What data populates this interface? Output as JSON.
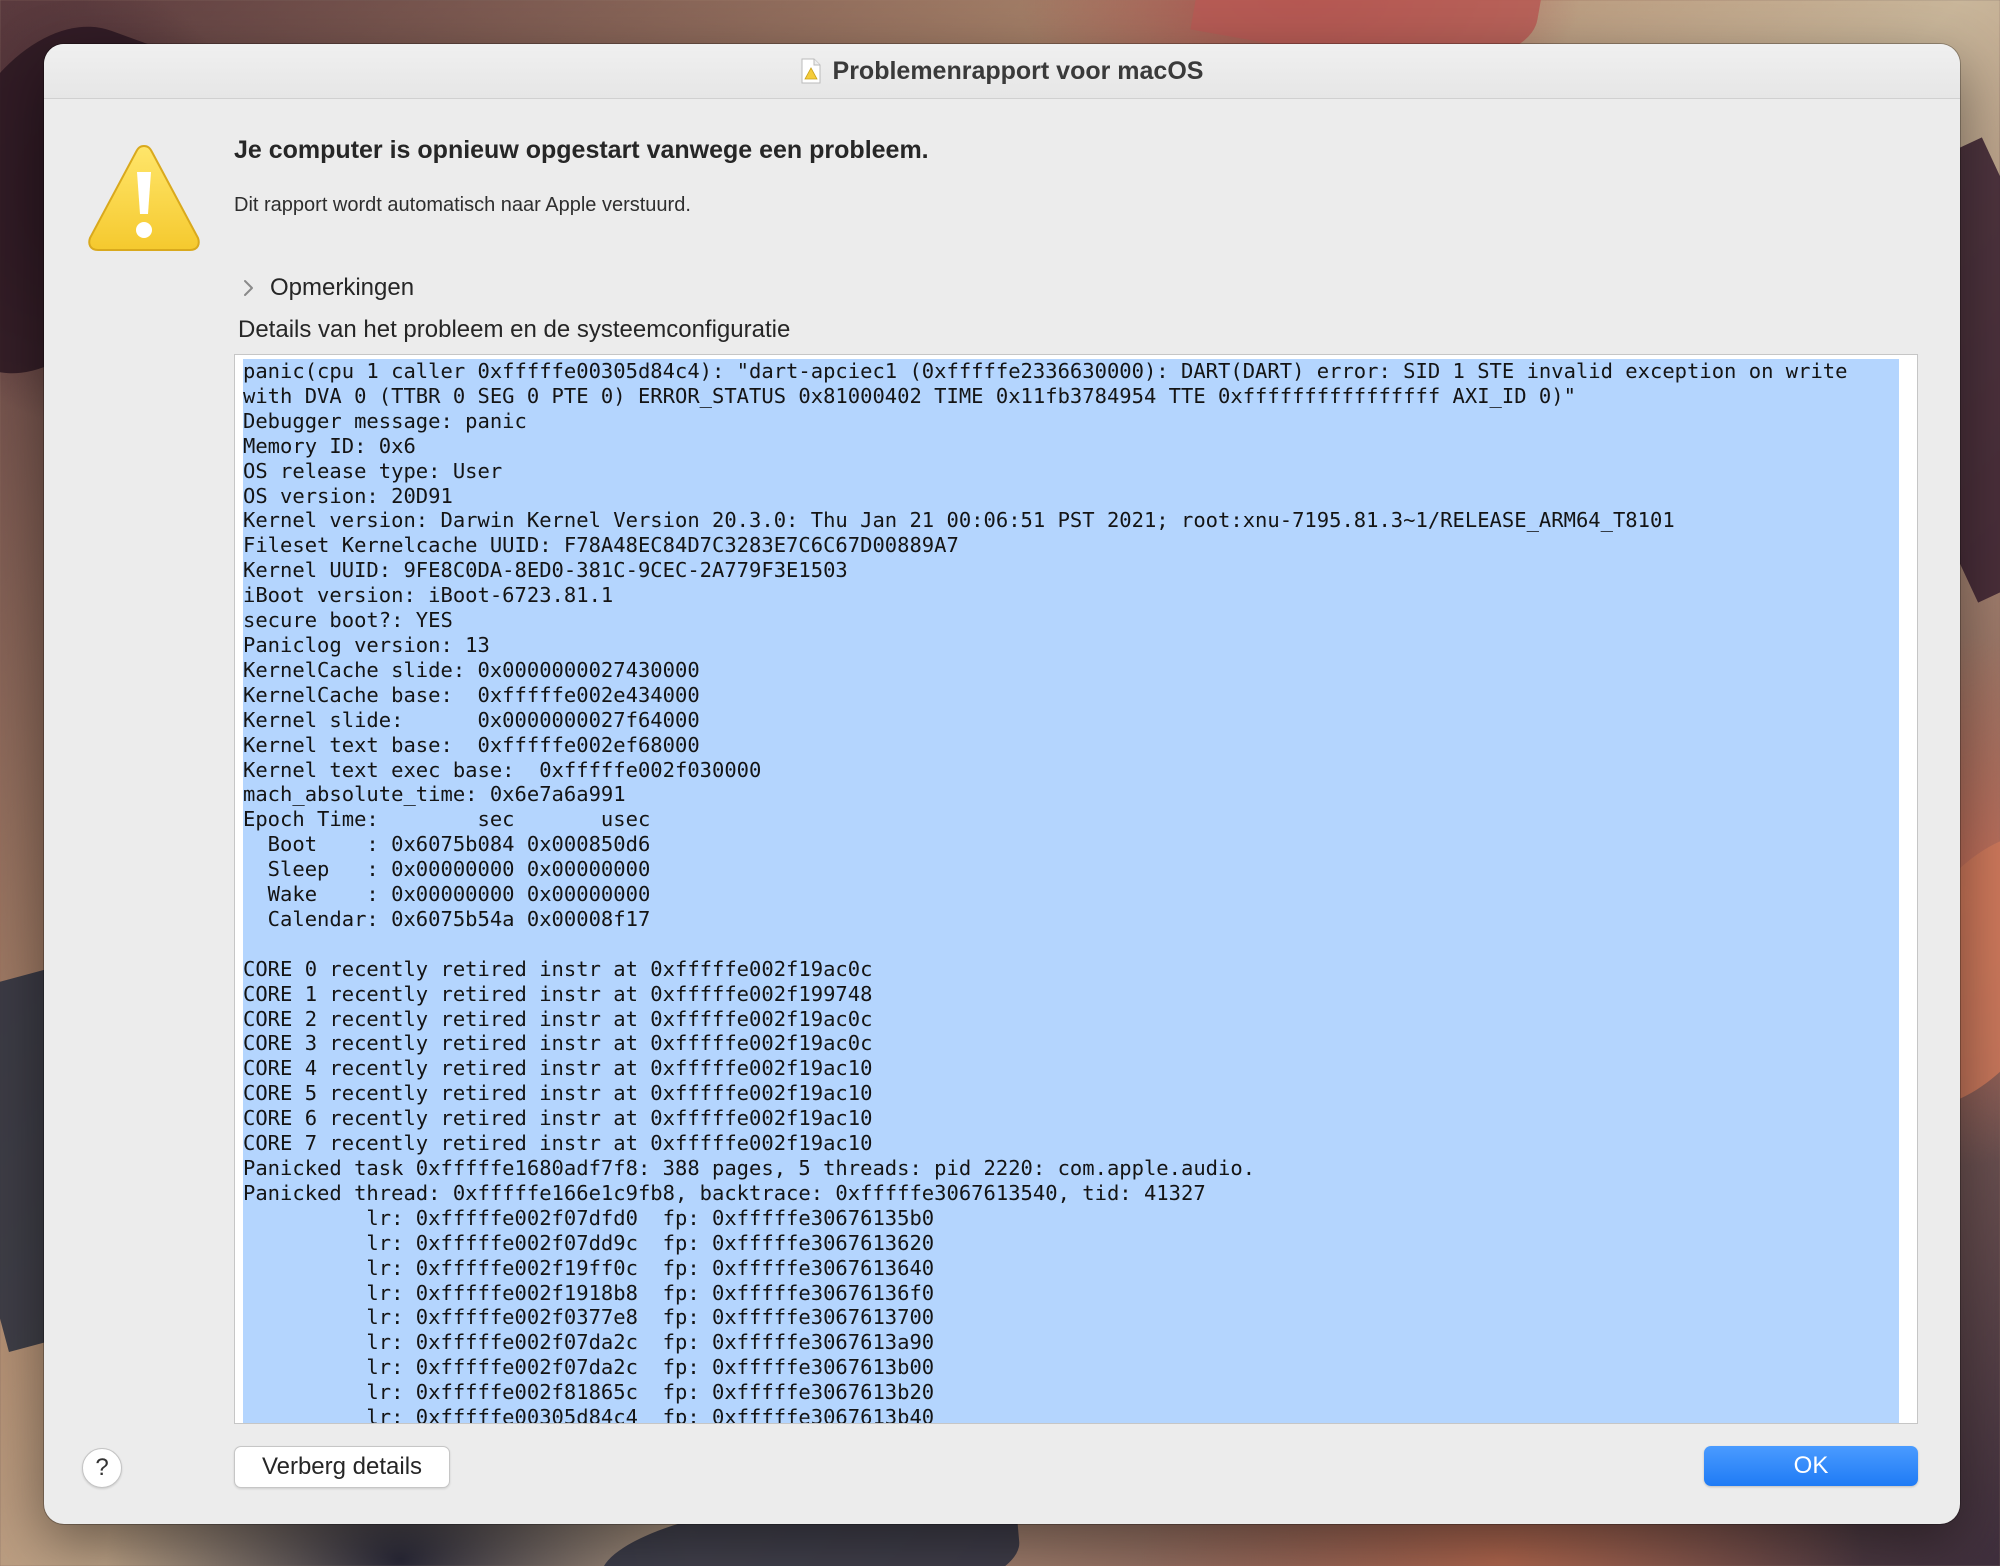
{
  "window": {
    "title": "Problemenrapport voor macOS",
    "title_icon": "console-report-icon"
  },
  "message": {
    "icon": "warning-icon",
    "headline": "Je computer is opnieuw opgestart vanwege een probleem.",
    "subline": "Dit rapport wordt automatisch naar Apple verstuurd."
  },
  "comments": {
    "label": "Opmerkingen",
    "expanded": false
  },
  "details": {
    "label": "Details van het probleem en de systeemconfiguratie",
    "lines": [
      "panic(cpu 1 caller 0xfffffe00305d84c4): \"dart-apciec1 (0xfffffe2336630000): DART(DART) error: SID 1 STE invalid exception on write",
      "with DVA 0 (TTBR 0 SEG 0 PTE 0) ERROR_STATUS 0x81000402 TIME 0x11fb3784954 TTE 0xffffffffffffffff AXI_ID 0)\"",
      "Debugger message: panic",
      "Memory ID: 0x6",
      "OS release type: User",
      "OS version: 20D91",
      "Kernel version: Darwin Kernel Version 20.3.0: Thu Jan 21 00:06:51 PST 2021; root:xnu-7195.81.3~1/RELEASE_ARM64_T8101",
      "Fileset Kernelcache UUID: F78A48EC84D7C3283E7C6C67D00889A7",
      "Kernel UUID: 9FE8C0DA-8ED0-381C-9CEC-2A779F3E1503",
      "iBoot version: iBoot-6723.81.1",
      "secure boot?: YES",
      "Paniclog version: 13",
      "KernelCache slide: 0x0000000027430000",
      "KernelCache base:  0xfffffe002e434000",
      "Kernel slide:      0x0000000027f64000",
      "Kernel text base:  0xfffffe002ef68000",
      "Kernel text exec base:  0xfffffe002f030000",
      "mach_absolute_time: 0x6e7a6a991",
      "Epoch Time:        sec       usec",
      "  Boot    : 0x6075b084 0x000850d6",
      "  Sleep   : 0x00000000 0x00000000",
      "  Wake    : 0x00000000 0x00000000",
      "  Calendar: 0x6075b54a 0x00008f17",
      "",
      "CORE 0 recently retired instr at 0xfffffe002f19ac0c",
      "CORE 1 recently retired instr at 0xfffffe002f199748",
      "CORE 2 recently retired instr at 0xfffffe002f19ac0c",
      "CORE 3 recently retired instr at 0xfffffe002f19ac0c",
      "CORE 4 recently retired instr at 0xfffffe002f19ac10",
      "CORE 5 recently retired instr at 0xfffffe002f19ac10",
      "CORE 6 recently retired instr at 0xfffffe002f19ac10",
      "CORE 7 recently retired instr at 0xfffffe002f19ac10",
      "Panicked task 0xfffffe1680adf7f8: 388 pages, 5 threads: pid 2220: com.apple.audio.",
      "Panicked thread: 0xfffffe166e1c9fb8, backtrace: 0xfffffe3067613540, tid: 41327",
      "          lr: 0xfffffe002f07dfd0  fp: 0xfffffe30676135b0",
      "          lr: 0xfffffe002f07dd9c  fp: 0xfffffe3067613620",
      "          lr: 0xfffffe002f19ff0c  fp: 0xfffffe3067613640",
      "          lr: 0xfffffe002f1918b8  fp: 0xfffffe30676136f0",
      "          lr: 0xfffffe002f0377e8  fp: 0xfffffe3067613700",
      "          lr: 0xfffffe002f07da2c  fp: 0xfffffe3067613a90",
      "          lr: 0xfffffe002f07da2c  fp: 0xfffffe3067613b00",
      "          lr: 0xfffffe002f81865c  fp: 0xfffffe3067613b20",
      "          lr: 0xfffffe00305d84c4  fp: 0xfffffe3067613b40"
    ],
    "selection_color": "#b4d5fe"
  },
  "footer": {
    "help_label": "?",
    "hide_details_label": "Verberg details",
    "ok_label": "OK",
    "accent_color": "#1f7bf5"
  }
}
